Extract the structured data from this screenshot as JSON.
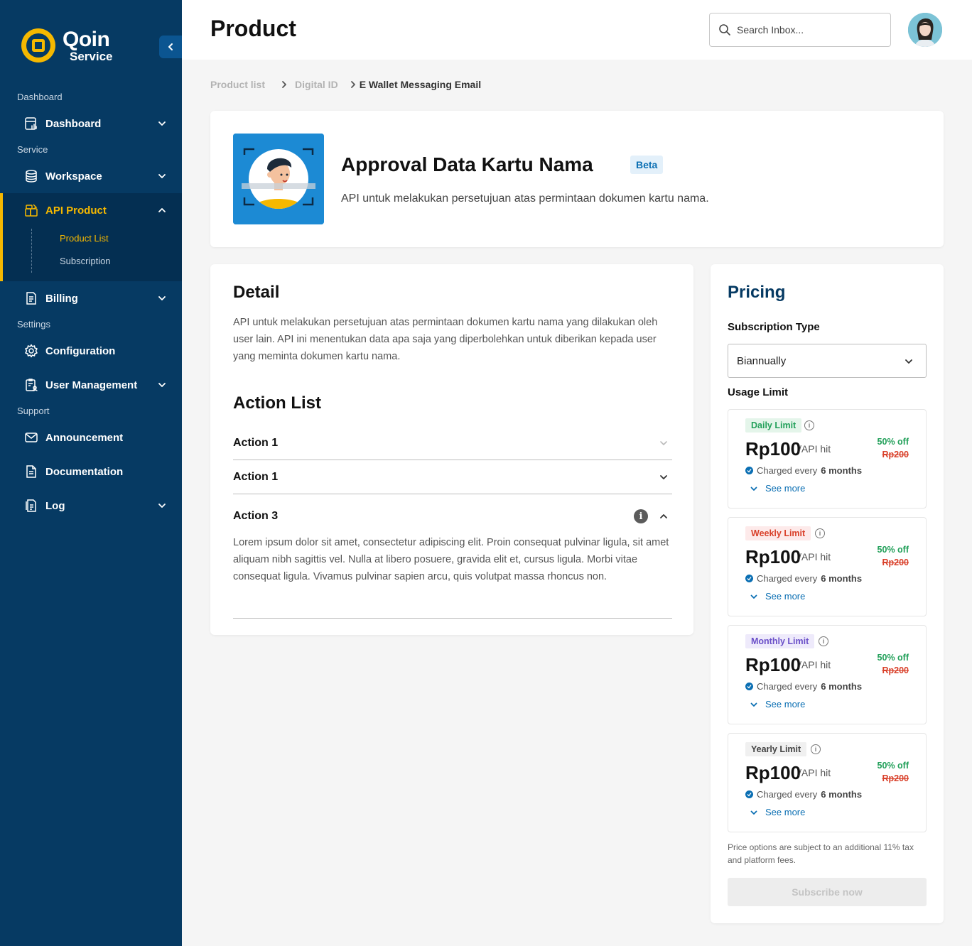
{
  "sidebar": {
    "brand_line1": "Qoin",
    "brand_line2": "Service",
    "sections": [
      "Dashboard",
      "Service",
      "Settings",
      "Support"
    ],
    "items": {
      "dashboard": "Dashboard",
      "workspace": "Workspace",
      "api_product": "API Product",
      "billing": "Billing",
      "configuration": "Configuration",
      "user_management": "User Management",
      "announcement": "Announcement",
      "documentation": "Documentation",
      "log": "Log"
    },
    "sub_items": [
      "Product List",
      "Subscription"
    ]
  },
  "header": {
    "title": "Product",
    "search_placeholder": "Search Inbox..."
  },
  "breadcrumb": [
    "Product list",
    "Digital ID",
    "E Wallet Messaging Email"
  ],
  "product": {
    "name": "Approval Data Kartu Nama",
    "badge": "Beta",
    "description": "API untuk melakukan persetujuan atas permintaan dokumen kartu nama."
  },
  "detail": {
    "title": "Detail",
    "text": "API untuk melakukan persetujuan atas permintaan dokumen kartu nama yang dilakukan oleh user lain. API ini menentukan data apa saja yang diperbolehkan untuk diberikan kepada user yang meminta dokumen kartu nama.",
    "action_list_title": "Action List",
    "actions": [
      {
        "label": "Action 1"
      },
      {
        "label": "Action 1"
      },
      {
        "label": "Action 3",
        "body": "Lorem ipsum dolor sit amet, consectetur adipiscing elit. Proin consequat pulvinar ligula, sit amet aliquam nibh sagittis vel. Nulla at libero posuere, gravida elit et, cursus ligula. Morbi vitae consequat ligula. Vivamus pulvinar sapien arcu, quis volutpat massa rhoncus non."
      }
    ]
  },
  "pricing": {
    "title": "Pricing",
    "subscription_type_label": "Subscription Type",
    "subscription_type_value": "Biannually",
    "usage_limit_label": "Usage Limit",
    "tiers": [
      {
        "name": "Daily Limit",
        "price": "Rp100",
        "unit": "/API hit",
        "discount": "50% off",
        "old_price": "Rp200",
        "charged": "Charged every",
        "period": "6 months",
        "more": "See more"
      },
      {
        "name": "Weekly Limit",
        "price": "Rp100",
        "unit": "/API hit",
        "discount": "50% off",
        "old_price": "Rp200",
        "charged": "Charged every",
        "period": "6 months",
        "more": "See more"
      },
      {
        "name": "Monthly Limit",
        "price": "Rp100",
        "unit": "/API hit",
        "discount": "50% off",
        "old_price": "Rp200",
        "charged": "Charged every",
        "period": "6 months",
        "more": "See more"
      },
      {
        "name": "Yearly Limit",
        "price": "Rp100",
        "unit": "/API hit",
        "discount": "50% off",
        "old_price": "Rp200",
        "charged": "Charged every",
        "period": "6 months",
        "more": "See more"
      }
    ],
    "note": "Price options are subject to an additional 11% tax and platform fees.",
    "subscribe_label": "Subscribe now"
  },
  "colors": {
    "sidebar_bg": "#063a63",
    "accent": "#f5b800",
    "link": "#0b6fb3",
    "discount": "#22a05a",
    "old_price": "#d9412b"
  }
}
